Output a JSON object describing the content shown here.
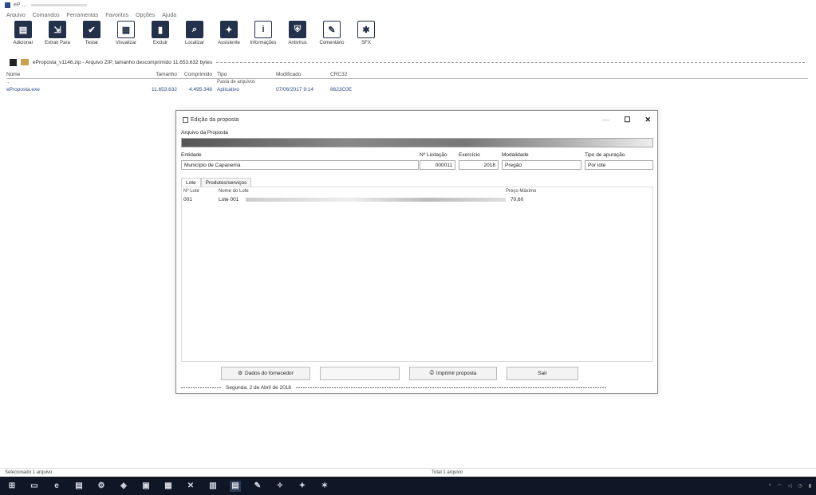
{
  "window": {
    "title": "eP ... "
  },
  "menu": [
    "Arquivo",
    "Comandos",
    "Ferramentas",
    "Favoritos",
    "Opções",
    "Ajuda"
  ],
  "toolbar": [
    {
      "label": "Adicionar",
      "icon": "add-archive-icon"
    },
    {
      "label": "Extrair Para",
      "icon": "extract-icon"
    },
    {
      "label": "Testar",
      "icon": "test-icon"
    },
    {
      "label": "Visualizar",
      "icon": "view-icon"
    },
    {
      "label": "Excluir",
      "icon": "delete-icon"
    },
    {
      "label": "Localizar",
      "icon": "find-icon"
    },
    {
      "label": "Assistente",
      "icon": "wizard-icon"
    },
    {
      "label": "Informações",
      "icon": "info-icon"
    },
    {
      "label": "Antivírus",
      "icon": "antivirus-icon"
    },
    {
      "label": "Comentário",
      "icon": "comment-icon"
    },
    {
      "label": "SFX",
      "icon": "sfx-icon"
    }
  ],
  "path": "eProposta_v1146.zip - Arquivo ZIP, tamanho descomprimido 11.653.632 bytes",
  "filelist": {
    "headers": {
      "name": "Nome",
      "size": "Tamanho",
      "comp": "Comprimido",
      "type": "Tipo",
      "mod": "Modificado",
      "crc": "CRC32"
    },
    "sub": "Pasta de arquivos",
    "row": {
      "name": "eProposta.exe",
      "size": "11.653.632",
      "comp": "4.495.348",
      "type": "Aplicativo",
      "mod": "07/06/2017 9:14",
      "crc": "8623C0E"
    }
  },
  "dialog": {
    "title": "Edição da proposta",
    "arquivo_label": "Arquivo da Proposta",
    "entidade_label": "Entidade",
    "entidade_value": "Município de Capanema",
    "licitacao_label": "Nº Licitação",
    "licitacao_value": "000011",
    "exercicio_label": "Exercício",
    "exercicio_value": "2018",
    "modalidade_label": "Modalidade",
    "modalidade_value": "Pregão",
    "tipo_label": "Tipo de apuração",
    "tipo_value": "Por lote",
    "tabs": [
      "Lote",
      "Produtos/serviços"
    ],
    "grid_headers": {
      "lote": "Nº Lote",
      "nome": "Nome do Lote",
      "preco": "Preço Máximo"
    },
    "grid_row": {
      "lote": "001",
      "nome": "Lote 001",
      "preco": "70,60"
    },
    "buttons": {
      "fornecedor": "Dados do fornecedor",
      "blank": "",
      "imprimir": "Imprimir proposta",
      "sair": "Sair"
    },
    "footer_date": "Segunda, 2 de Abril de 2018"
  },
  "statusbar": {
    "left": "Selecionado 1 arquivo",
    "right": "Total 1 arquivo"
  },
  "colors": {
    "accent": "#2a4d86",
    "taskbar": "#0f1626"
  }
}
